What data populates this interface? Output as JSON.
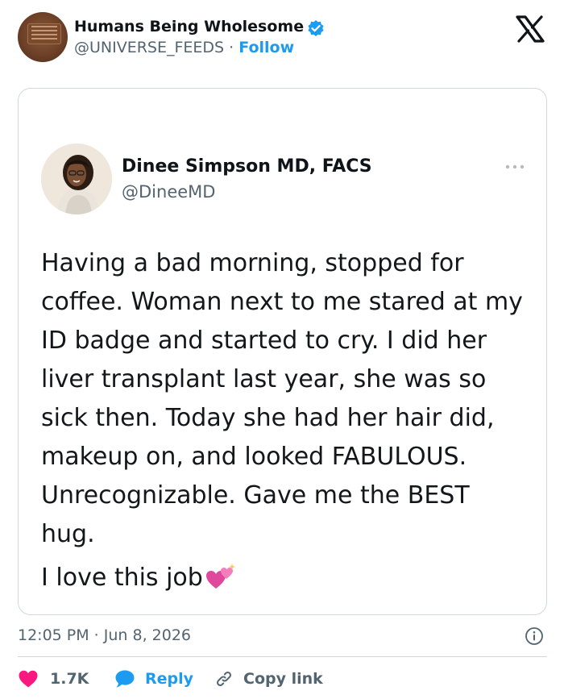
{
  "header": {
    "author_name": "Humans Being Wholesome",
    "author_handle": "@UNIVERSE_FEEDS",
    "separator": "·",
    "follow_label": "Follow"
  },
  "quoted_tweet": {
    "name": "Dinee Simpson MD, FACS",
    "handle": "@DineeMD",
    "body": "Having a bad morning, stopped for coffee. Woman next to me stared at my ID badge and started to cry. I did her liver transplant last year, she was so sick then. Today she had her hair did, makeup on, and looked FABULOUS.  Unrecognizable. Gave me the BEST hug.",
    "closing": "I love this job"
  },
  "meta": {
    "timestamp": "12:05 PM · Jun 8, 2026"
  },
  "actions": {
    "like_count": "1.7K",
    "reply_label": "Reply",
    "copy_label": "Copy link"
  },
  "icons": [
    "verified-badge-icon",
    "x-logo-icon",
    "more-options-icon",
    "sparkling-hearts-icon",
    "info-icon",
    "heart-icon",
    "reply-bubble-icon",
    "link-icon"
  ],
  "colors": {
    "accent": "#1d9bf0",
    "like": "#f91880",
    "secondary_text": "#536471",
    "border": "#cfd9de"
  }
}
